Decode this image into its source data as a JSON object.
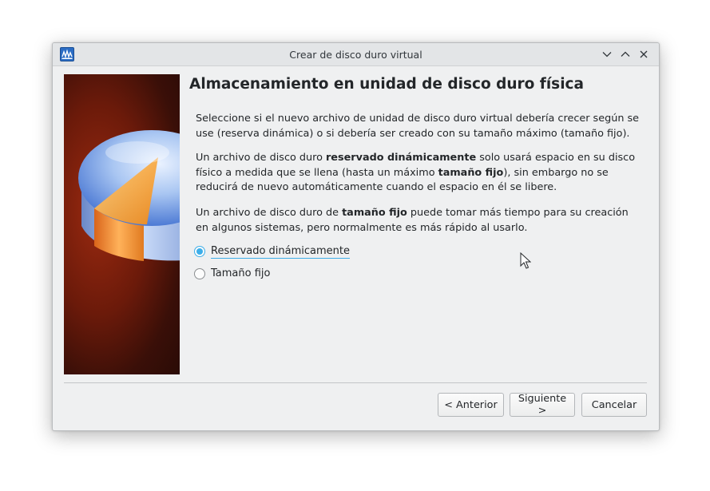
{
  "window": {
    "title": "Crear de disco duro virtual",
    "controls": [
      "minimize",
      "maximize",
      "close"
    ]
  },
  "page": {
    "heading": "Almacenamiento en unidad de disco duro física",
    "paragraph1": "Seleccione si el nuevo archivo de unidad de disco duro virtual debería crecer según se use (reserva dinámica) o si debería ser creado con su tamaño máximo (tamaño fijo).",
    "paragraph2": {
      "part1": "Un archivo de disco duro ",
      "bold1": "reservado dinámicamente",
      "part2": " solo usará espacio en su disco físico a medida que se llena (hasta un máximo ",
      "bold2": "tamaño fijo",
      "part3": "), sin embargo no se reducirá de nuevo automáticamente cuando el espacio en él se libere."
    },
    "paragraph3": {
      "part1": "Un archivo de disco duro de ",
      "bold1": "tamaño fijo",
      "part2": " puede tomar más tiempo para su creación en algunos sistemas, pero normalmente es más rápido al usarlo."
    },
    "options": [
      {
        "label": "Reservado dinámicamente",
        "checked": true
      },
      {
        "label": "Tamaño fijo",
        "checked": false
      }
    ]
  },
  "buttons": {
    "back": "< Anterior",
    "next": "Siguiente >",
    "cancel": "Cancelar"
  },
  "colors": {
    "accent": "#3daee9",
    "window_bg": "#eff0f1",
    "titlebar_bg": "#e3e5e7"
  }
}
